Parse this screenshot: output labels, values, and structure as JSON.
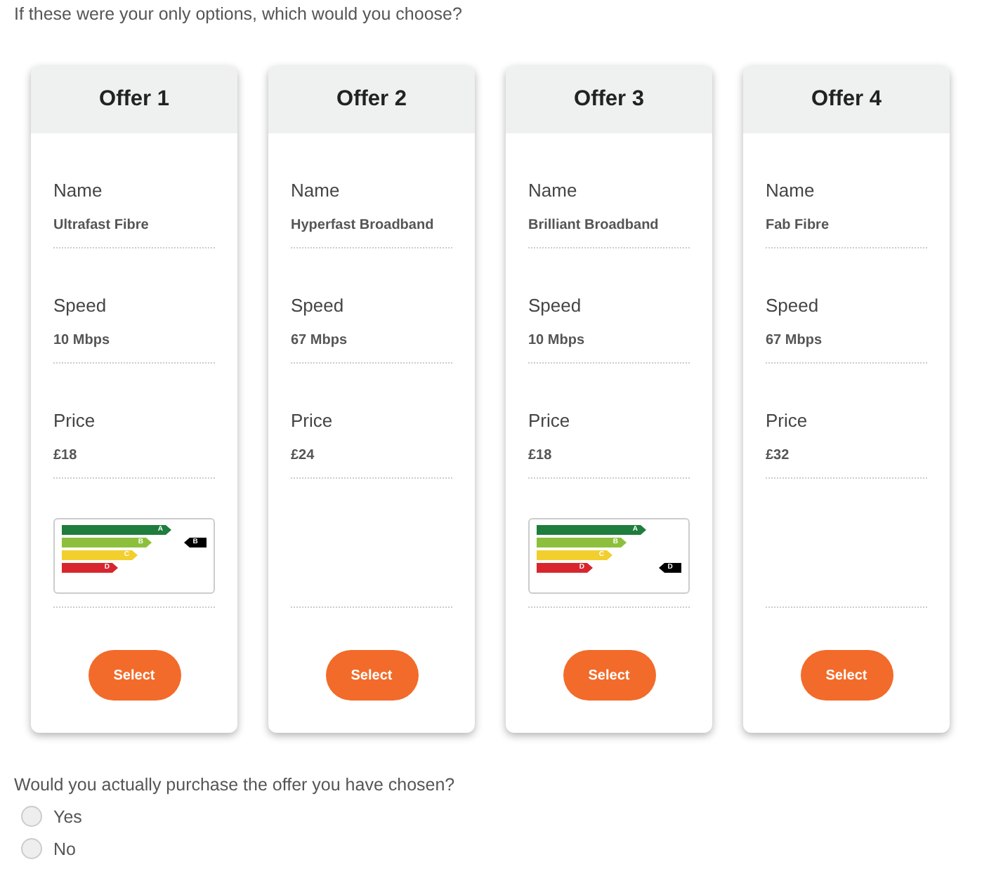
{
  "question": "If these were your only options, which would you choose?",
  "offers": [
    {
      "title": "Offer 1",
      "fields": [
        {
          "label": "Name",
          "value": "Ultrafast Fibre"
        },
        {
          "label": "Speed",
          "value": "10 Mbps"
        },
        {
          "label": "Price",
          "value": "£18"
        }
      ],
      "rating_label": {
        "bands": [
          {
            "letter": "A",
            "color": "#1f7d3e",
            "selected": false
          },
          {
            "letter": "B",
            "color": "#8cc03c",
            "selected": true
          },
          {
            "letter": "C",
            "color": "#f2cf2e",
            "selected": false
          },
          {
            "letter": "D",
            "color": "#d8262e",
            "selected": false
          }
        ],
        "pointer": "B"
      },
      "button": "Select"
    },
    {
      "title": "Offer 2",
      "fields": [
        {
          "label": "Name",
          "value": "Hyperfast Broadband"
        },
        {
          "label": "Speed",
          "value": "67 Mbps"
        },
        {
          "label": "Price",
          "value": "£24"
        }
      ],
      "button": "Select"
    },
    {
      "title": "Offer 3",
      "fields": [
        {
          "label": "Name",
          "value": "Brilliant Broadband"
        },
        {
          "label": "Speed",
          "value": "10 Mbps"
        },
        {
          "label": "Price",
          "value": "£18"
        }
      ],
      "rating_label": {
        "bands": [
          {
            "letter": "A",
            "color": "#1f7d3e",
            "selected": false
          },
          {
            "letter": "B",
            "color": "#8cc03c",
            "selected": false
          },
          {
            "letter": "C",
            "color": "#f2cf2e",
            "selected": false
          },
          {
            "letter": "D",
            "color": "#d8262e",
            "selected": true
          }
        ],
        "pointer": "D"
      },
      "button": "Select"
    },
    {
      "title": "Offer 4",
      "fields": [
        {
          "label": "Name",
          "value": "Fab Fibre"
        },
        {
          "label": "Speed",
          "value": "67 Mbps"
        },
        {
          "label": "Price",
          "value": "£32"
        }
      ],
      "button": "Select"
    }
  ],
  "purchase_question": "Would you actually purchase the offer you have chosen?",
  "purchase_options": [
    {
      "label": "Yes",
      "selected": false
    },
    {
      "label": "No",
      "selected": false
    }
  ]
}
